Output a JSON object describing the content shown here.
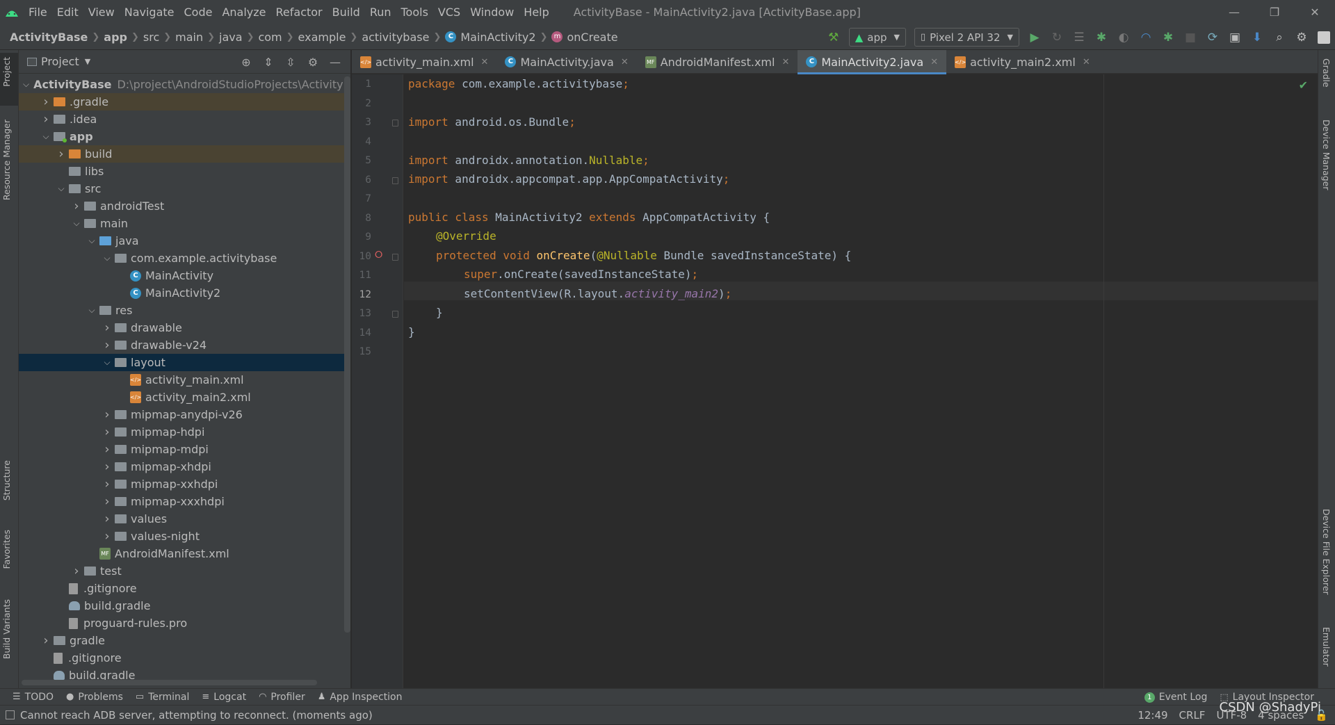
{
  "menubar": {
    "items": [
      "File",
      "Edit",
      "View",
      "Navigate",
      "Code",
      "Analyze",
      "Refactor",
      "Build",
      "Run",
      "Tools",
      "VCS",
      "Window",
      "Help"
    ],
    "window_title": "ActivityBase - MainActivity2.java [ActivityBase.app]"
  },
  "breadcrumb": [
    "ActivityBase",
    "app",
    "src",
    "main",
    "java",
    "com",
    "example",
    "activitybase",
    "MainActivity2",
    "onCreate"
  ],
  "toolbar": {
    "run_config": "app",
    "device": "Pixel 2 API 32"
  },
  "project_panel": {
    "title": "Project",
    "root_path": "D:\\project\\AndroidStudioProjects\\ActivityBa",
    "tree": [
      {
        "label": "ActivityBase",
        "depth": 0
      },
      {
        "label": ".gradle",
        "depth": 1
      },
      {
        "label": ".idea",
        "depth": 1
      },
      {
        "label": "app",
        "depth": 1
      },
      {
        "label": "build",
        "depth": 2
      },
      {
        "label": "libs",
        "depth": 2
      },
      {
        "label": "src",
        "depth": 2
      },
      {
        "label": "androidTest",
        "depth": 3
      },
      {
        "label": "main",
        "depth": 3
      },
      {
        "label": "java",
        "depth": 4
      },
      {
        "label": "com.example.activitybase",
        "depth": 5
      },
      {
        "label": "MainActivity",
        "depth": 6
      },
      {
        "label": "MainActivity2",
        "depth": 6
      },
      {
        "label": "res",
        "depth": 4
      },
      {
        "label": "drawable",
        "depth": 5
      },
      {
        "label": "drawable-v24",
        "depth": 5
      },
      {
        "label": "layout",
        "depth": 5
      },
      {
        "label": "activity_main.xml",
        "depth": 6
      },
      {
        "label": "activity_main2.xml",
        "depth": 6
      },
      {
        "label": "mipmap-anydpi-v26",
        "depth": 5
      },
      {
        "label": "mipmap-hdpi",
        "depth": 5
      },
      {
        "label": "mipmap-mdpi",
        "depth": 5
      },
      {
        "label": "mipmap-xhdpi",
        "depth": 5
      },
      {
        "label": "mipmap-xxhdpi",
        "depth": 5
      },
      {
        "label": "mipmap-xxxhdpi",
        "depth": 5
      },
      {
        "label": "values",
        "depth": 5
      },
      {
        "label": "values-night",
        "depth": 5
      },
      {
        "label": "AndroidManifest.xml",
        "depth": 4
      },
      {
        "label": "test",
        "depth": 3
      },
      {
        "label": ".gitignore",
        "depth": 2
      },
      {
        "label": "build.gradle",
        "depth": 2
      },
      {
        "label": "proguard-rules.pro",
        "depth": 2
      },
      {
        "label": "gradle",
        "depth": 1
      },
      {
        "label": ".gitignore",
        "depth": 1
      },
      {
        "label": "build.gradle",
        "depth": 1
      }
    ]
  },
  "editor_tabs": [
    "activity_main.xml",
    "MainActivity.java",
    "AndroidManifest.xml",
    "MainActivity2.java",
    "activity_main2.xml"
  ],
  "active_tab": "MainActivity2.java",
  "line_numbers": [
    "1",
    "2",
    "3",
    "4",
    "5",
    "6",
    "7",
    "8",
    "9",
    "10",
    "11",
    "12",
    "13",
    "14",
    "15"
  ],
  "code": {
    "l1_kw": "package",
    "l1_rest": " com.example.activitybase",
    "l3_kw": "import",
    "l3_rest": " android.os.Bundle",
    "l5_kw": "import",
    "l5_rest": " androidx.annotation.",
    "l5_an": "Nullable",
    "l6_kw": "import",
    "l6_rest": " androidx.appcompat.app.AppCompatActivity",
    "l8_kw1": "public class",
    "l8_name": " MainActivity2 ",
    "l8_kw2": "extends",
    "l8_rest": " AppCompatActivity {",
    "l9_an": "@Override",
    "l10_kw": "protected void",
    "l10_fn": "onCreate",
    "l10_p": "(",
    "l10_an": "@Nullable",
    "l10_rest": " Bundle savedInstanceState) {",
    "l11_kw": "super",
    "l11_rest": ".onCreate(savedInstanceState)",
    "l12_pre": "setContentView(R.layout.",
    "l12_it": "activity_main2",
    "l12_post": ")",
    "l13": "}",
    "l14": "}",
    "semicolon": ";"
  },
  "left_strip": [
    "Project",
    "Resource Manager",
    "Structure",
    "Favorites",
    "Build Variants"
  ],
  "right_strip": [
    "Gradle",
    "Device Manager",
    "Device File Explorer",
    "Emulator"
  ],
  "bottom_tabs": [
    "TODO",
    "Problems",
    "Terminal",
    "Logcat",
    "Profiler",
    "App Inspection"
  ],
  "bottom_right_tabs": [
    "Event Log",
    "Layout Inspector"
  ],
  "status": {
    "message": "Cannot reach ADB server, attempting to reconnect. (moments ago)",
    "position": "12:49",
    "line_sep": "CRLF",
    "encoding": "UTF-8",
    "indent": "4 spaces",
    "watermark": "CSDN @ShadyPi"
  },
  "colors": {
    "accent": "#4a88c7",
    "selection": "#0d293e",
    "keyword": "#cc7832",
    "function": "#ffc66d"
  }
}
